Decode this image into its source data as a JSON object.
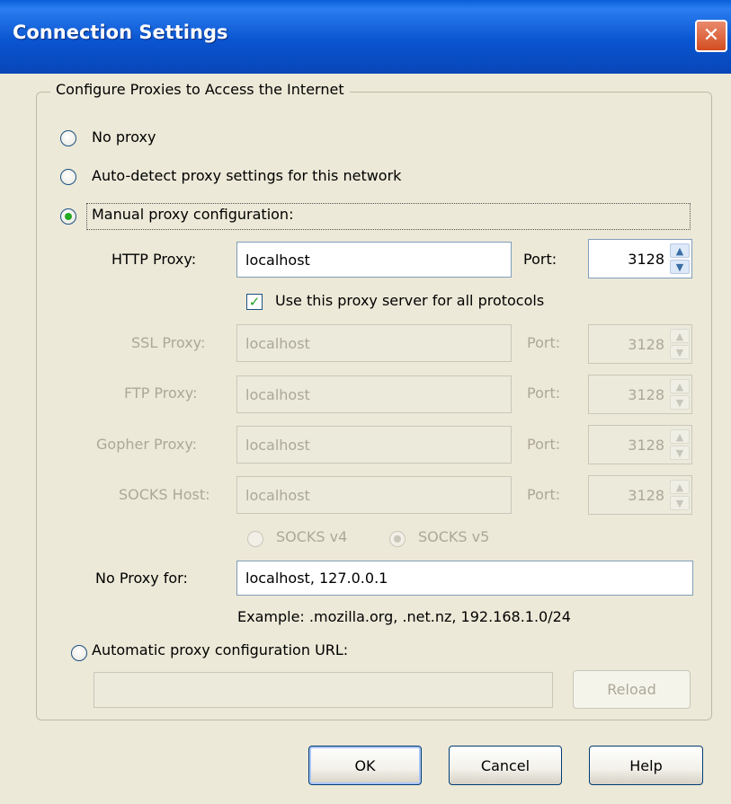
{
  "window": {
    "title": "Connection Settings",
    "close_glyph": "✕"
  },
  "group": {
    "legend": "Configure Proxies to Access the Internet"
  },
  "options": {
    "no_proxy": "No proxy",
    "auto_detect": "Auto-detect proxy settings for this network",
    "manual": "Manual proxy configuration:",
    "auto_url": "Automatic proxy configuration URL:"
  },
  "selected_option": "manual",
  "http": {
    "label": "HTTP Proxy:",
    "value": "localhost",
    "port_label": "Port:",
    "port": "3128"
  },
  "use_for_all": {
    "label": "Use this proxy server for all protocols",
    "checked": true,
    "check_glyph": "✓"
  },
  "ssl": {
    "label": "SSL Proxy:",
    "value": "localhost",
    "port_label": "Port:",
    "port": "3128"
  },
  "ftp": {
    "label": "FTP Proxy:",
    "value": "localhost",
    "port_label": "Port:",
    "port": "3128"
  },
  "gopher": {
    "label": "Gopher Proxy:",
    "value": "localhost",
    "port_label": "Port:",
    "port": "3128"
  },
  "socks": {
    "label": "SOCKS Host:",
    "value": "localhost",
    "port_label": "Port:",
    "port": "3128",
    "v4_label": "SOCKS v4",
    "v5_label": "SOCKS v5",
    "selected": "v5"
  },
  "no_proxy_for": {
    "label": "No Proxy for:",
    "value": "localhost, 127.0.0.1",
    "example": "Example: .mozilla.org, .net.nz, 192.168.1.0/24"
  },
  "auto_url_field": {
    "value": ""
  },
  "buttons": {
    "reload": "Reload",
    "ok": "OK",
    "cancel": "Cancel",
    "help": "Help"
  },
  "spin_glyphs": {
    "up": "▲",
    "down": "▼"
  },
  "colors": {
    "titlebar": "#0a55d0",
    "dialog_bg": "#ece9d8",
    "close_button": "#d34d20",
    "radio_dot": "#22aa22",
    "disabled_text": "#aca899"
  }
}
